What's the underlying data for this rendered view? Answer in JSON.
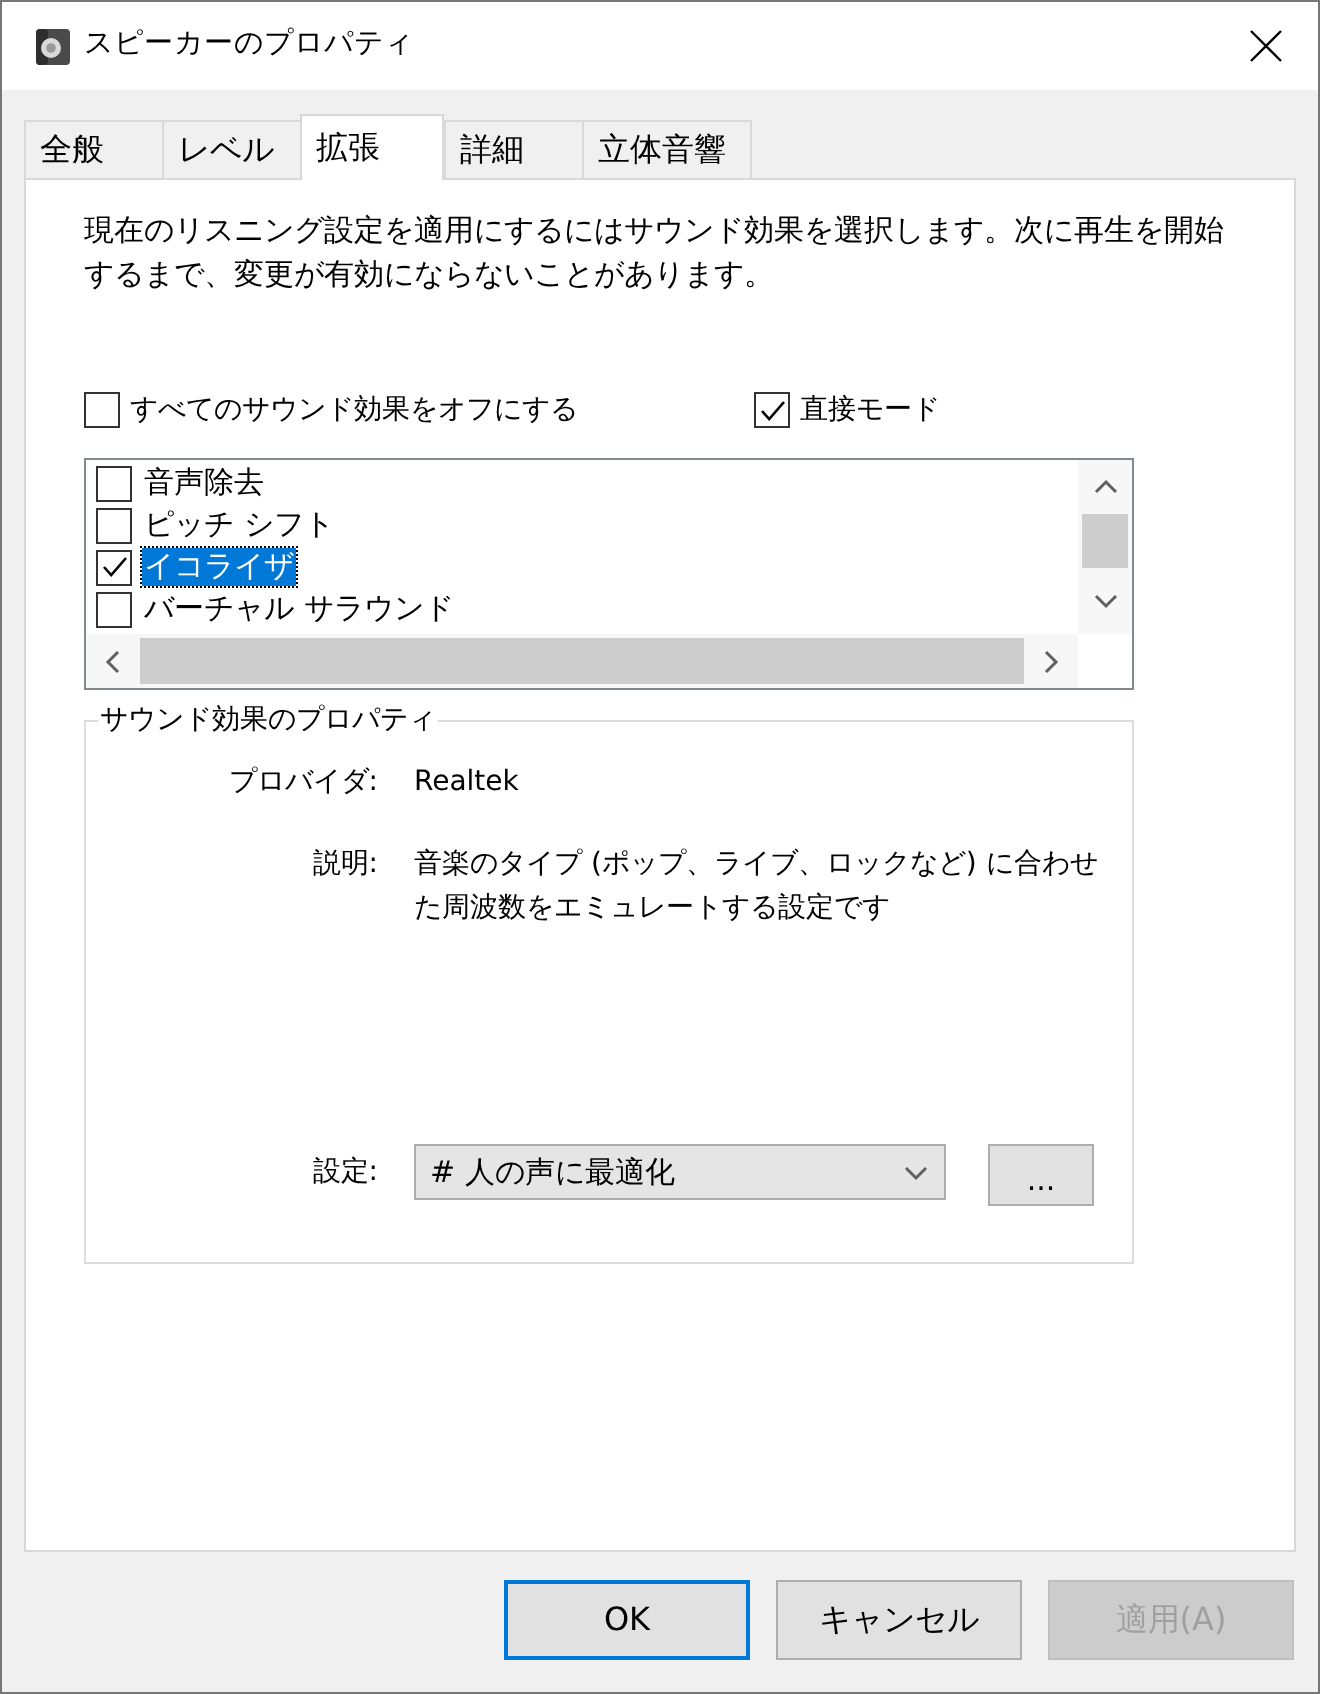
{
  "window": {
    "title": "スピーカーのプロパティ"
  },
  "tabs": [
    {
      "label": "全般",
      "selected": false
    },
    {
      "label": "レベル",
      "selected": false
    },
    {
      "label": "拡張",
      "selected": true
    },
    {
      "label": "詳細",
      "selected": false
    },
    {
      "label": "立体音響",
      "selected": false
    }
  ],
  "description": "現在のリスニング設定を適用にするにはサウンド効果を選択します。次に再生を開始するまで、変更が有効にならないことがあります。",
  "options": [
    {
      "label": "すべてのサウンド効果をオフにする",
      "checked": false
    },
    {
      "label": "直接モード",
      "checked": true
    }
  ],
  "effects": [
    {
      "label": "音声除去",
      "checked": false,
      "selected": false
    },
    {
      "label": "ピッチ シフト",
      "checked": false,
      "selected": false
    },
    {
      "label": "イコライザ",
      "checked": true,
      "selected": true
    },
    {
      "label": "バーチャル サラウンド",
      "checked": false,
      "selected": false
    }
  ],
  "properties": {
    "title": "サウンド効果のプロパティ",
    "fields": [
      {
        "label": "プロバイダ:",
        "value": "Realtek"
      },
      {
        "label": "説明:",
        "value": "音楽のタイプ (ポップ、ライブ、ロックなど) に合わせた周波数をエミュレートする設定です"
      }
    ],
    "setting": {
      "label": "設定:",
      "value": "# 人の声に最適化",
      "more_button": "..."
    }
  },
  "buttons": [
    {
      "label": "OK",
      "default": true,
      "disabled": false
    },
    {
      "label": "キャンセル",
      "default": false,
      "disabled": false
    },
    {
      "label": "適用(A)",
      "default": false,
      "disabled": true
    }
  ]
}
